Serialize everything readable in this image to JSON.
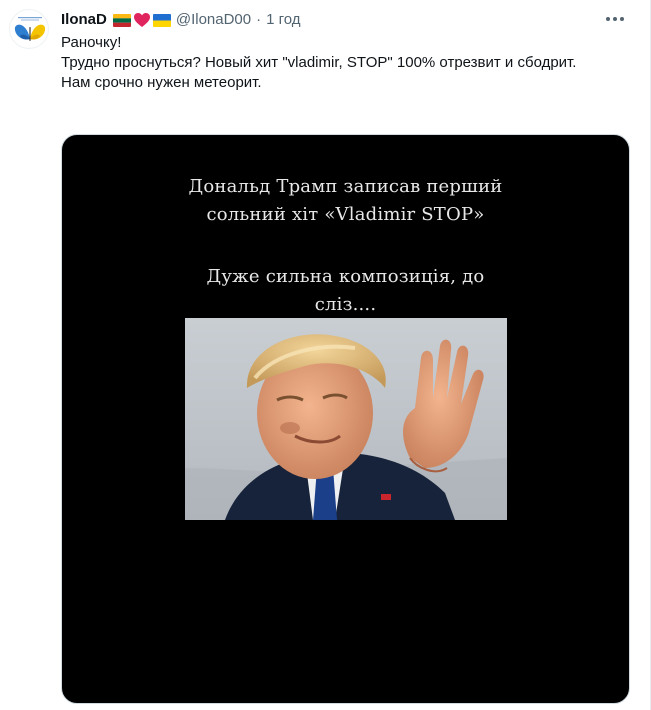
{
  "author": {
    "name": "IlonaD",
    "handle": "@IlonaD00",
    "time": "1 год",
    "separator": "·",
    "avatar_icon": "butterfly-logo-icon",
    "name_emojis": [
      "lithuania-flag-icon",
      "red-heart-icon",
      "ukraine-flag-icon"
    ]
  },
  "tweet": {
    "lines": [
      "Раночку!",
      "Трудно проснуться? Новый хит \"vladimir, STOP\" 100% отрезвит и сбодрит.",
      "Нам срочно нужен метеорит."
    ]
  },
  "media": {
    "caption_1_line_1": "Дональд Трамп записав перший",
    "caption_1_line_2": "сольний хіт «Vladimir STOP»",
    "caption_2_line_1": "Дуже сильна композиція, до",
    "caption_2_line_2": "сліз....",
    "photo_subject": "man-raising-hand-photo"
  },
  "colors": {
    "text_primary": "#0f1419",
    "text_secondary": "#536471",
    "media_background": "#000000"
  },
  "icons": {
    "more": "more-options-icon"
  }
}
